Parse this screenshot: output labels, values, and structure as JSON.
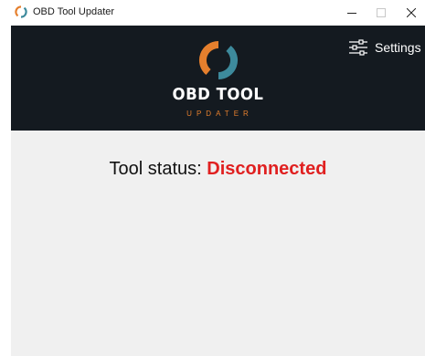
{
  "window": {
    "title": "OBD Tool Updater",
    "minimize_icon": "minimize-icon",
    "maximize_icon": "maximize-icon",
    "close_icon": "close-icon",
    "app_icon": "app-logo-icon"
  },
  "header": {
    "logo_title": "OBD TOOL",
    "logo_subtitle": "UPDATER",
    "settings_label": "Settings",
    "settings_icon": "sliders-icon",
    "colors": {
      "background": "#141a20",
      "accent_orange": "#e57f2d",
      "accent_teal": "#3d8a9c"
    }
  },
  "main": {
    "status_label": "Tool status:",
    "status_value": "Disconnected",
    "status_color": "#e02020",
    "background": "#f0f0f0"
  }
}
